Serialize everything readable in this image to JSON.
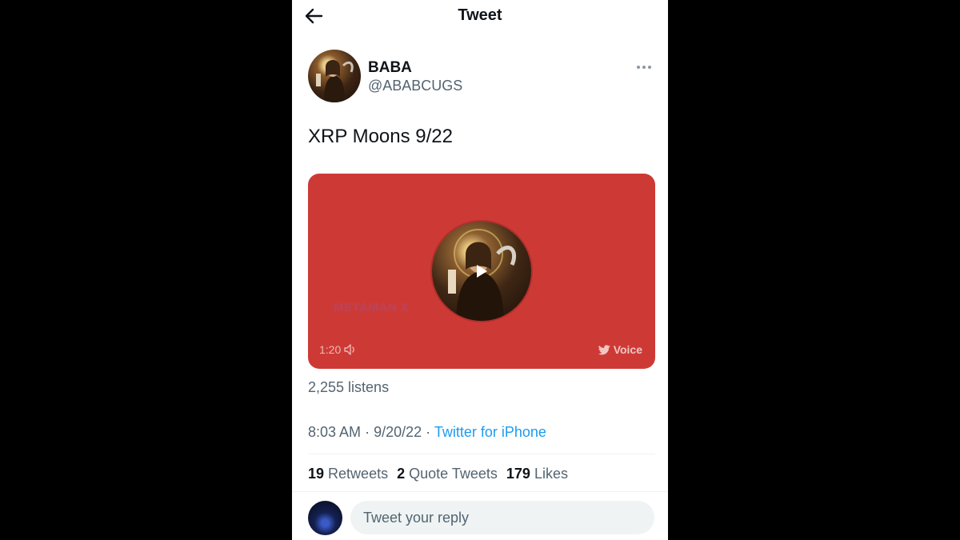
{
  "header": {
    "title": "Tweet",
    "back_icon": "arrow-left-icon"
  },
  "author": {
    "display_name": "BABA",
    "handle": "@ABABCUGS",
    "more_icon": "more-dots-icon"
  },
  "tweet": {
    "text": "XRP Moons 9/22"
  },
  "voice_card": {
    "background_color": "#cd3a36",
    "watermark": "METAMAN X",
    "duration": "1:20",
    "label": "Voice",
    "play_icon": "play-icon",
    "speaker_icon": "speaker-icon",
    "bird_icon": "twitter-bird-icon"
  },
  "listens": "2,255 listens",
  "meta": {
    "time": "8:03 AM",
    "separator": "·",
    "date": "9/20/22",
    "source": "Twitter for iPhone"
  },
  "stats": {
    "retweets_count": "19",
    "retweets_label": "Retweets",
    "quotes_count": "2",
    "quotes_label": "Quote Tweets",
    "likes_count": "179",
    "likes_label": "Likes"
  },
  "reply": {
    "placeholder": "Tweet your reply"
  },
  "colors": {
    "accent": "#1d9bf0",
    "secondary_text": "#536471",
    "primary_text": "#0f1419"
  }
}
